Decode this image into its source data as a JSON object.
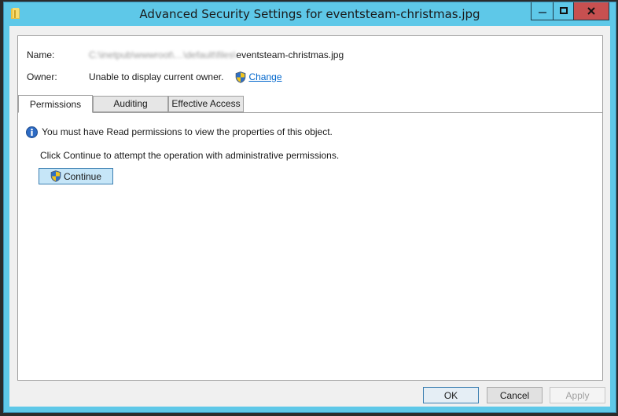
{
  "window": {
    "title": "Advanced Security Settings for eventsteam-christmas.jpg",
    "controls": {
      "minimize": "minimize",
      "maximize": "maximize",
      "close": "close"
    }
  },
  "info": {
    "name_label": "Name:",
    "name_value_blurred": "C:\\inetpub\\wwwroot\\…\\default\\files\\",
    "name_value_visible": "eventsteam-christmas.jpg",
    "owner_label": "Owner:",
    "owner_value": "Unable to display current owner.",
    "change_link": "Change"
  },
  "tabs": [
    {
      "label": "Permissions",
      "active": true
    },
    {
      "label": "Auditing",
      "active": false
    },
    {
      "label": "Effective Access",
      "active": false
    }
  ],
  "permissions": {
    "info_message": "You must have Read permissions to view the properties of this object.",
    "hint": "Click Continue to attempt the operation with administrative permissions.",
    "continue_label": "Continue"
  },
  "footer": {
    "ok": "OK",
    "cancel": "Cancel",
    "apply": "Apply"
  },
  "colors": {
    "frame": "#5ec8e8",
    "close": "#c75050",
    "link": "#0066cc",
    "continue_bg": "#c6e6f8"
  }
}
